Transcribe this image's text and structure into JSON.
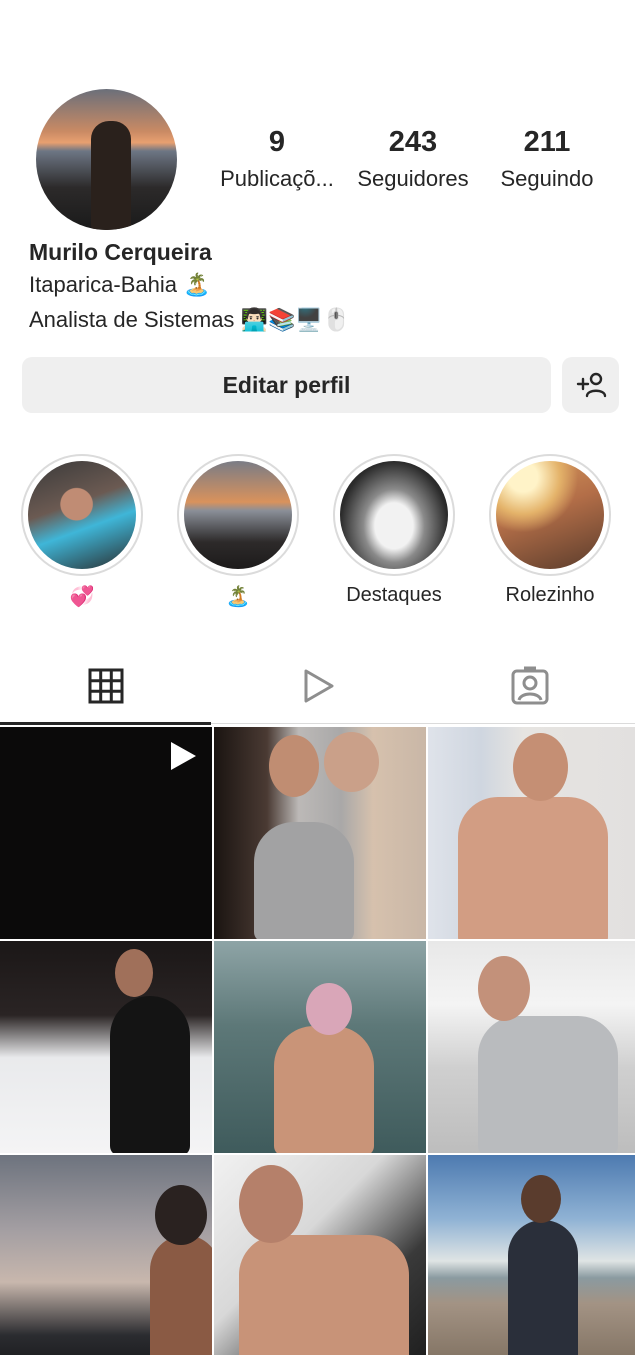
{
  "profile": {
    "stats": [
      {
        "value": "9",
        "label": "Publicaçõ..."
      },
      {
        "value": "243",
        "label": "Seguidores"
      },
      {
        "value": "211",
        "label": "Seguindo"
      }
    ],
    "name": "Murilo Cerqueira",
    "bio_line1": "Itaparica-Bahia 🏝️",
    "bio_line2": "Analista de Sistemas 👨🏻‍💻📚🖥️🖱️"
  },
  "actions": {
    "edit_label": "Editar perfil",
    "add_icon": "add-person-icon"
  },
  "highlights": [
    {
      "caption": "💞"
    },
    {
      "caption": "🏝️"
    },
    {
      "caption": "Destaques"
    },
    {
      "caption": "Rolezinho"
    }
  ],
  "tabs": [
    {
      "icon": "grid-icon",
      "active": true
    },
    {
      "icon": "reels-icon",
      "active": false
    },
    {
      "icon": "tagged-icon",
      "active": false
    }
  ],
  "posts": [
    {
      "kind": "video"
    },
    {
      "kind": "photo"
    },
    {
      "kind": "photo"
    },
    {
      "kind": "photo"
    },
    {
      "kind": "photo"
    },
    {
      "kind": "photo"
    },
    {
      "kind": "photo"
    },
    {
      "kind": "photo"
    },
    {
      "kind": "photo"
    }
  ],
  "colors": {
    "text": "#262626",
    "button_bg": "#efefef",
    "divider": "#dbdbdb"
  }
}
